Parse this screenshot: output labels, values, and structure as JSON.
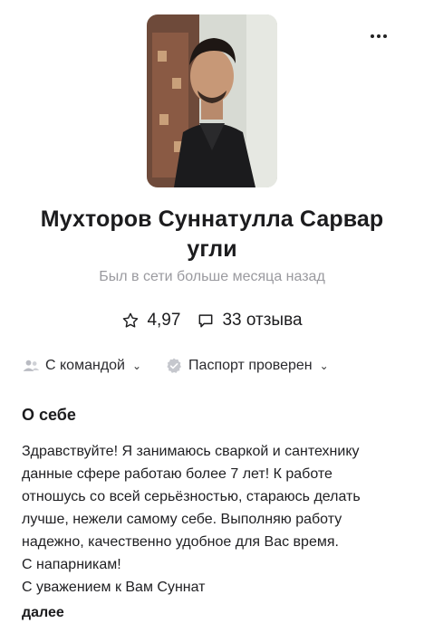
{
  "profile": {
    "name": "Мухторов Суннатулла Сарвар угли",
    "status": "Был в сети больше месяца назад",
    "rating": "4,97",
    "reviews": "33 отзыва"
  },
  "chips": {
    "team_label": "С командой",
    "passport_label": "Паспорт проверен"
  },
  "about": {
    "title": "О себе",
    "text": "Здравствуйте! Я занимаюсь сваркой и сантехнику\nданные сфере работаю более 7 лет! К работе\nотношусь со всей серьёзностью, стараюсь делать\nлучше, нежели самому себе. Выполняю работу\nнадежно, качественно удобное для Вас время.\nС напарникам!\nС уважением к Вам Суннат",
    "more_label": "далее"
  },
  "icons": {
    "more": "more-dots-icon",
    "rating": "star-icon",
    "reviews": "speech-bubble-icon",
    "team": "people-icon",
    "passport": "verified-badge-icon"
  }
}
